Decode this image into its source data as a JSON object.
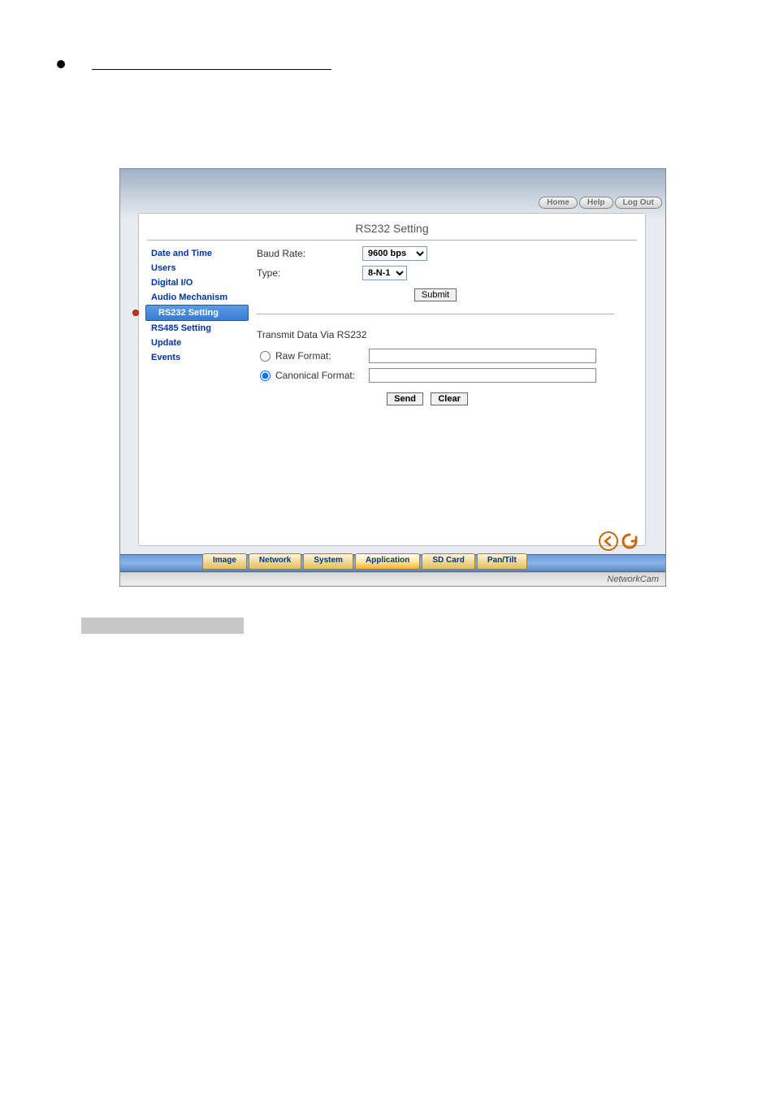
{
  "topButtons": {
    "home": "Home",
    "help": "Help",
    "logout": "Log Out"
  },
  "panel": {
    "title": "RS232 Setting"
  },
  "sidebar": {
    "items": [
      {
        "label": "Date and Time",
        "active": false
      },
      {
        "label": "Users",
        "active": false
      },
      {
        "label": "Digital I/O",
        "active": false
      },
      {
        "label": "Audio Mechanism",
        "active": false
      },
      {
        "label": "RS232 Setting",
        "active": true
      },
      {
        "label": "RS485 Setting",
        "active": false
      },
      {
        "label": "Update",
        "active": false
      },
      {
        "label": "Events",
        "active": false
      }
    ]
  },
  "form": {
    "baudRateLabel": "Baud Rate:",
    "baudRateValue": "9600 bps",
    "typeLabel": "Type:",
    "typeValue": "8-N-1",
    "submitLabel": "Submit"
  },
  "transmit": {
    "title": "Transmit Data Via RS232",
    "rawLabel": "Raw Format:",
    "canonicalLabel": "Canonical Format:",
    "selected": "canonical",
    "sendLabel": "Send",
    "clearLabel": "Clear"
  },
  "bottomTabs": {
    "items": [
      {
        "label": "Image",
        "active": false
      },
      {
        "label": "Network",
        "active": false
      },
      {
        "label": "System",
        "active": false
      },
      {
        "label": "Application",
        "active": true
      },
      {
        "label": "SD Card",
        "active": false
      },
      {
        "label": "Pan/Tilt",
        "active": false
      }
    ]
  },
  "footer": {
    "brand": "NetworkCam"
  }
}
